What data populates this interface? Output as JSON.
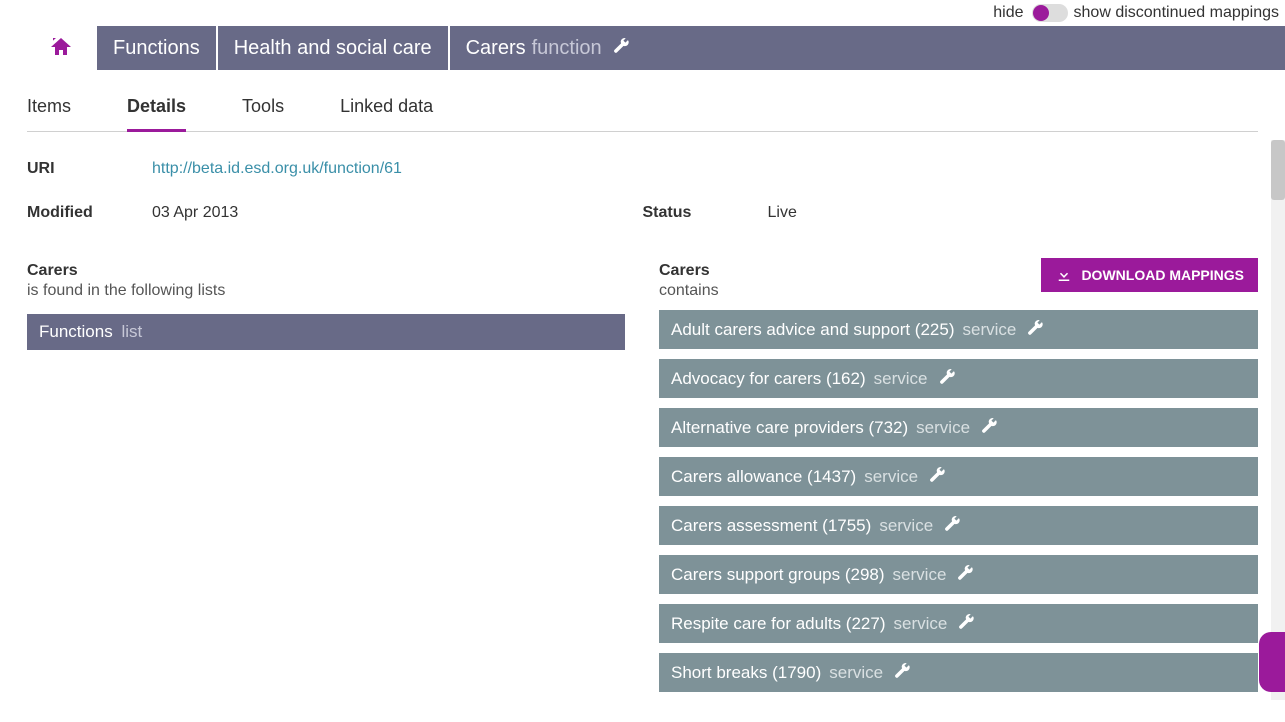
{
  "toggle": {
    "left": "hide",
    "right": "show discontinued mappings"
  },
  "breadcrumb": {
    "items": [
      {
        "label": "Functions"
      },
      {
        "label": "Health and social care"
      },
      {
        "label": "Carers",
        "type": "function",
        "current": true
      }
    ]
  },
  "subtabs": [
    {
      "label": "Items",
      "active": false
    },
    {
      "label": "Details",
      "active": true
    },
    {
      "label": "Tools",
      "active": false
    },
    {
      "label": "Linked data",
      "active": false
    }
  ],
  "details": {
    "uri_label": "URI",
    "uri_value": "http://beta.id.esd.org.uk/function/61",
    "modified_label": "Modified",
    "modified_value": "03 Apr 2013",
    "status_label": "Status",
    "status_value": "Live"
  },
  "left_col": {
    "heading": "Carers",
    "sub": "is found in the following lists",
    "items": [
      {
        "label": "Functions",
        "suffix": "list"
      }
    ]
  },
  "right_col": {
    "heading": "Carers",
    "sub": "contains",
    "download": "DOWNLOAD MAPPINGS",
    "items": [
      {
        "label": "Adult carers advice and support (225)",
        "suffix": "service"
      },
      {
        "label": "Advocacy for carers (162)",
        "suffix": "service"
      },
      {
        "label": "Alternative care providers (732)",
        "suffix": "service"
      },
      {
        "label": "Carers allowance (1437)",
        "suffix": "service"
      },
      {
        "label": "Carers assessment (1755)",
        "suffix": "service"
      },
      {
        "label": "Carers support groups (298)",
        "suffix": "service"
      },
      {
        "label": "Respite care for adults (227)",
        "suffix": "service"
      },
      {
        "label": "Short breaks (1790)",
        "suffix": "service"
      }
    ]
  }
}
